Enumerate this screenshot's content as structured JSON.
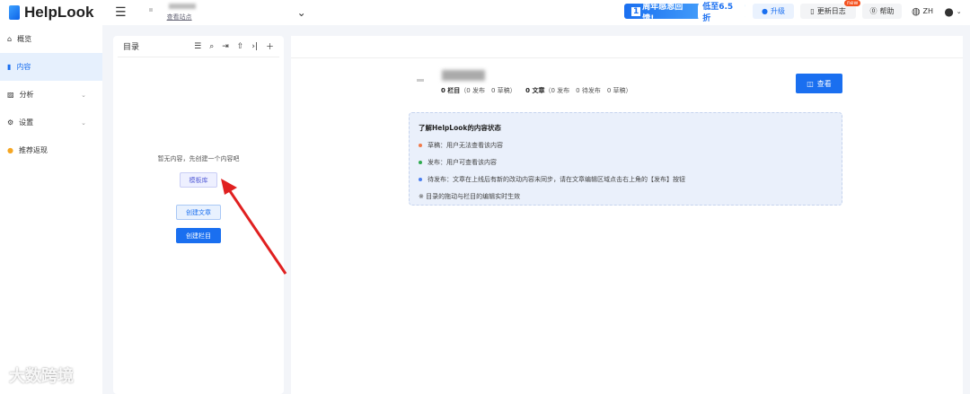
{
  "header": {
    "brand": "HelpLook",
    "site_link": "查看站点",
    "promo": "周年感恩回馈!",
    "promo_num": "1",
    "promo_badge": "低至6.5折",
    "upgrade": "升级",
    "changelog": "更新日志",
    "new_badge": "new",
    "help": "帮助",
    "lang": "ZH"
  },
  "sidebar": {
    "items": [
      {
        "label": "概览"
      },
      {
        "label": "内容"
      },
      {
        "label": "分析"
      },
      {
        "label": "设置"
      },
      {
        "label": "推荐返现"
      }
    ]
  },
  "catalog": {
    "title": "目录",
    "empty": "暂无内容，先创建一个内容吧",
    "template": "模板库",
    "create_article": "创建文章",
    "create_column": "创建栏目"
  },
  "main": {
    "columns": "0 栏目",
    "columns_detail": "（0 发布　0 草稿）",
    "articles": "0 文章",
    "articles_detail": "（0 发布　0 待发布　0 草稿）",
    "view": "查看",
    "info": {
      "title": "了解HelpLook的内容状态",
      "items": [
        {
          "text": "草稿：用户无法查看该内容",
          "color": "#f07a4a"
        },
        {
          "text": "发布：用户可查看该内容",
          "color": "#2eaa4f"
        },
        {
          "text": "待发布：文章在上线后有新的改动内容未同步，请在文章编辑区域点击右上角的【发布】按钮",
          "color": "#4a7ef0"
        }
      ],
      "note": "※ 目录的拖动与栏目的编辑实时生效"
    }
  },
  "watermark": "大数跨境"
}
